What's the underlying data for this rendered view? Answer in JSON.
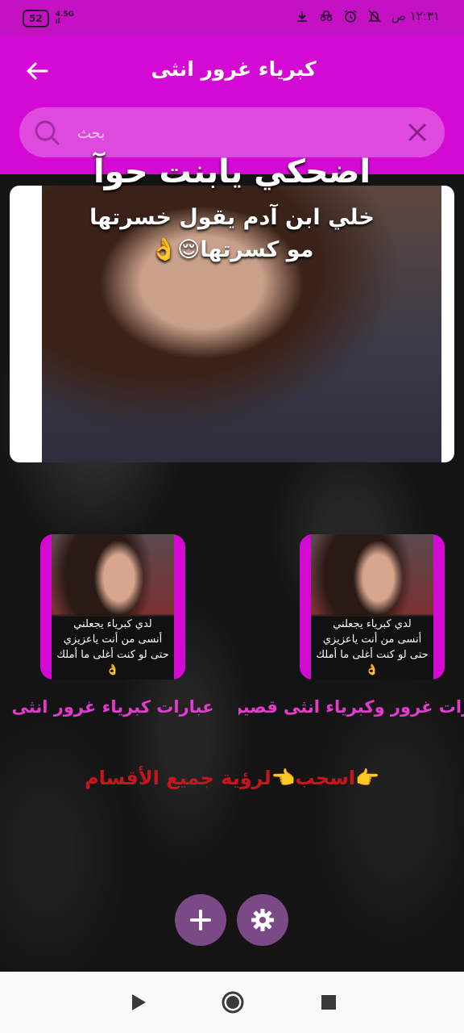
{
  "status_bar": {
    "battery": "52",
    "network_top": "4.5G",
    "network_bottom": "ıl",
    "time": "١٢:٣١ ص",
    "icons": [
      "mute-icon",
      "alarm-icon",
      "incognito-icon",
      "download-icon"
    ]
  },
  "header": {
    "title": "كبرياء غرور انثى",
    "search_placeholder": "بحث"
  },
  "hero": {
    "line1": "اضحكي يابنت حوآ",
    "line2": "خلي ابن آدم يقول خسرتها",
    "line3": "مو كسرتها😌👌"
  },
  "categories": [
    {
      "label": "عبارات كبرياء غرور انثى",
      "image_text": [
        "لدي كبرياء يجعلني",
        "أنسى من أنت ياعزيزي",
        "حتى لو كنت أغلى ما أملك👌"
      ]
    },
    {
      "label": "عبارات غرور وكبرياء انثى قصيرة",
      "image_text": [
        "لدي كبرياء يجعلني",
        "أنسى من أنت ياعزيزي",
        "حتى لو كنت أغلى ما أملك👌"
      ]
    }
  ],
  "swipe_hint": "👉اسحب👈لرؤية جميع الأقسام",
  "fabs": {
    "add_icon": "plus-icon",
    "settings_icon": "gear-icon"
  },
  "colors": {
    "primary": "#d30ad3",
    "accent": "#7b4a86",
    "hint_text": "#c4161c",
    "category_label": "#e43ad0"
  }
}
